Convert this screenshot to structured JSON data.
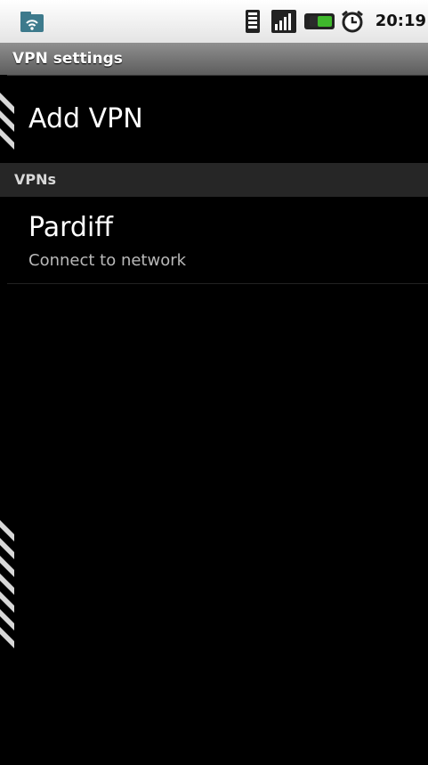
{
  "status_bar": {
    "time": "20:19",
    "icons": {
      "left": "app-notification-icon",
      "vibrate": "phone-vibrate-icon",
      "signal": "signal-strength-icon",
      "battery": "battery-icon",
      "alarm": "alarm-clock-icon"
    }
  },
  "title_bar": {
    "title": "VPN settings"
  },
  "add_vpn": {
    "label": "Add VPN"
  },
  "section": {
    "title": "VPNs"
  },
  "vpns": [
    {
      "name": "Pardiff",
      "status": "Connect to network"
    }
  ],
  "colors": {
    "background": "#000000",
    "status_bar": "#f0f0f0",
    "title_bar": "#7a7a7a",
    "section_header": "#262626",
    "battery_green": "#3fb82c"
  }
}
